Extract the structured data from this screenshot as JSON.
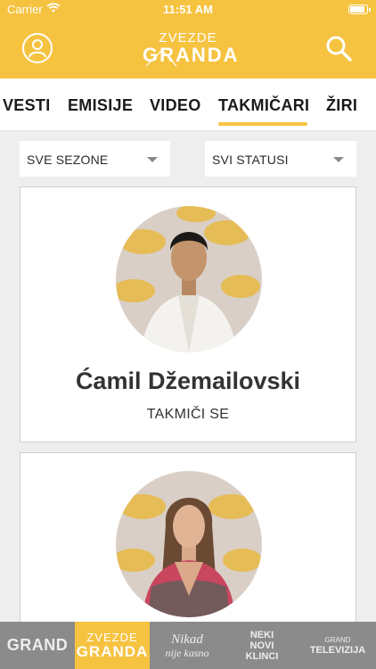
{
  "status_bar": {
    "carrier": "Carrier",
    "time": "11:51 AM",
    "battery_level": 0.9
  },
  "header": {
    "logo_line1": "ZVEZDE",
    "logo_line2": "GRANDA",
    "profile_icon": "user-icon",
    "search_icon": "search-icon",
    "accent_color": "#f6c341"
  },
  "tabs": [
    {
      "label": "VESTI"
    },
    {
      "label": "EMISIJE"
    },
    {
      "label": "VIDEO"
    },
    {
      "label": "TAKMIČARI",
      "active": true
    },
    {
      "label": "ŽIRI"
    }
  ],
  "filters": {
    "season": "SVE SEZONE",
    "status": "SVI STATUSI"
  },
  "contestants": [
    {
      "name": "Ćamil Džemailovski",
      "status": "TAKMIČI SE"
    },
    {
      "name": "",
      "status": ""
    }
  ],
  "bottom_nav": [
    {
      "label": "GRAND"
    },
    {
      "label_line1": "ZVEZDE",
      "label_line2": "GRANDA",
      "active": true
    },
    {
      "label_line1": "Nikad",
      "label_line2": "nije kasno"
    },
    {
      "label_line1": "NEKI",
      "label_line2": "NOVI",
      "label_line3": "KLINCI"
    },
    {
      "label_line1": "GRAND",
      "label_line2": "TELEVIZIJA"
    }
  ]
}
